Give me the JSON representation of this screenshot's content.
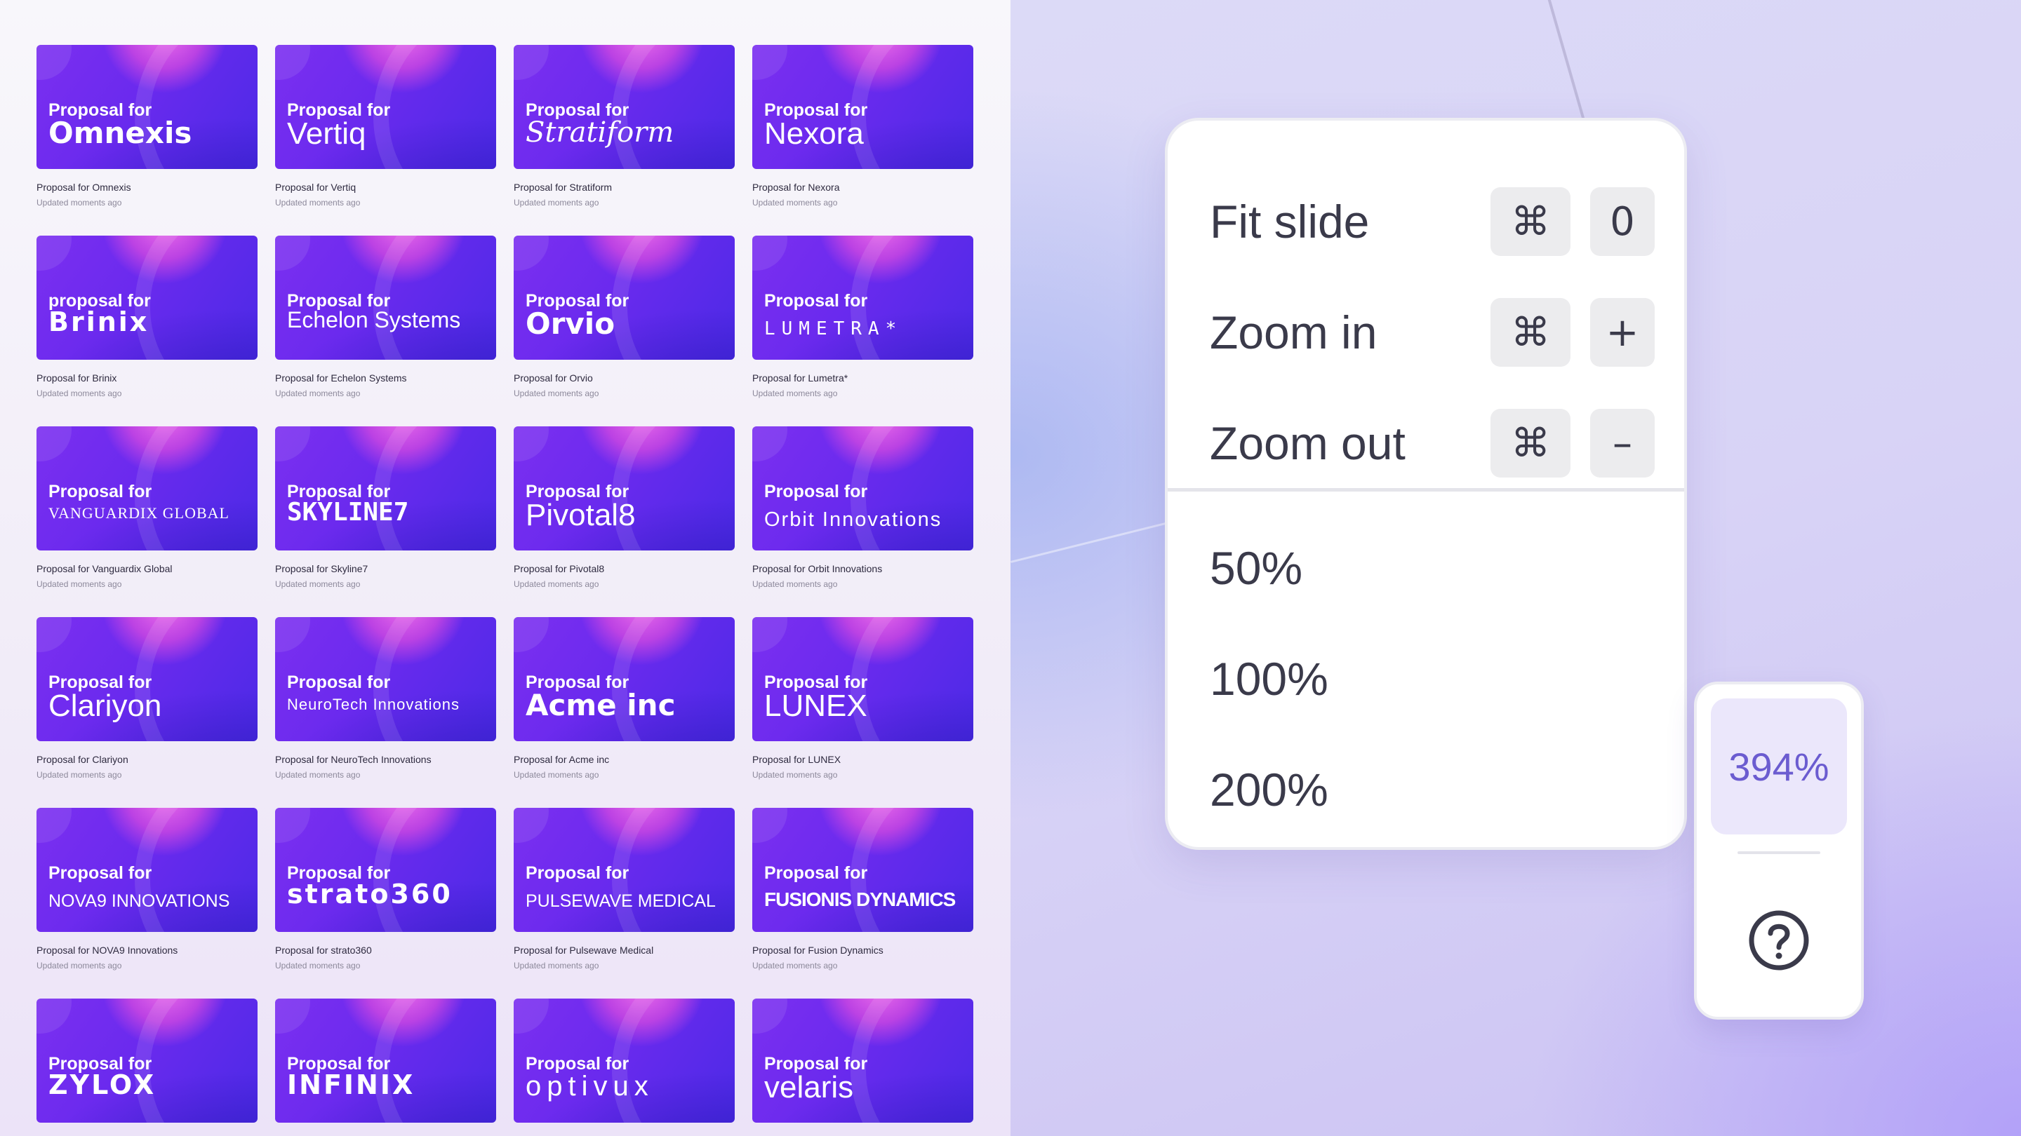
{
  "cards": [
    {
      "kicker": "Proposal for",
      "brand": "Omnexis",
      "style": "b-heavy",
      "title": "Proposal for Omnexis",
      "updated": "Updated moments ago"
    },
    {
      "kicker": "Proposal for",
      "brand": "Vertiq",
      "style": "b-light",
      "title": "Proposal for Vertiq",
      "updated": "Updated moments ago"
    },
    {
      "kicker": "Proposal for",
      "brand": "Stratiform",
      "style": "b-script",
      "title": "Proposal for Stratiform",
      "updated": "Updated moments ago"
    },
    {
      "kicker": "Proposal for",
      "brand": "Nexora",
      "style": "b-light",
      "title": "Proposal for Nexora",
      "updated": "Updated moments ago"
    },
    {
      "kicker": "proposal for",
      "brand": "Brinix",
      "style": "b-wide",
      "title": "Proposal for Brinix",
      "updated": "Updated moments ago"
    },
    {
      "kicker": "Proposal for",
      "brand": "Echelon Systems",
      "style": "b-mid",
      "title": "Proposal for Echelon Systems",
      "updated": "Updated moments ago"
    },
    {
      "kicker": "Proposal for",
      "brand": "Orvio",
      "style": "b-heavy",
      "title": "Proposal for Orvio",
      "updated": "Updated moments ago"
    },
    {
      "kicker": "Proposal for",
      "brand": "LUMETRA*",
      "style": "b-spaced",
      "title": "Proposal for Lumetra*",
      "updated": "Updated moments ago"
    },
    {
      "kicker": "Proposal for",
      "brand": "Vanguardix Global",
      "style": "b-serif-small",
      "title": "Proposal for Vanguardix Global",
      "updated": "Updated moments ago"
    },
    {
      "kicker": "Proposal for",
      "brand": "SKYLINE7",
      "style": "b-mono",
      "title": "Proposal for Skyline7",
      "updated": "Updated moments ago"
    },
    {
      "kicker": "Proposal for",
      "brand": "Pivotal8",
      "style": "b-light",
      "title": "Proposal for Pivotal8",
      "updated": "Updated moments ago"
    },
    {
      "kicker": "Proposal for",
      "brand": "Orbit Innovations",
      "style": "b-orbit",
      "title": "Proposal for Orbit Innovations",
      "updated": "Updated moments ago"
    },
    {
      "kicker": "Proposal for",
      "brand": "Clariyon",
      "style": "b-light",
      "title": "Proposal for Clariyon",
      "updated": "Updated moments ago"
    },
    {
      "kicker": "Proposal for",
      "brand": "NeuroTech Innovations",
      "style": "b-small2",
      "title": "Proposal for NeuroTech Innovations",
      "updated": "Updated moments ago"
    },
    {
      "kicker": "Proposal for",
      "brand": "Acme inc",
      "style": "b-heavy",
      "title": "Proposal for Acme inc",
      "updated": "Updated moments ago"
    },
    {
      "kicker": "Proposal for",
      "brand": "LUNEX",
      "style": "b-light",
      "title": "Proposal for LUNEX",
      "updated": "Updated moments ago"
    },
    {
      "kicker": "Proposal for",
      "brand": "NOVA9 INNOVATIONS",
      "style": "b-caps-sm",
      "title": "Proposal for NOVA9 Innovations",
      "updated": "Updated moments ago"
    },
    {
      "kicker": "Proposal for",
      "brand": "strato360",
      "style": "b-wide",
      "title": "Proposal for strato360",
      "updated": "Updated moments ago"
    },
    {
      "kicker": "Proposal for",
      "brand": "PULSEWAVE MEDICAL",
      "style": "b-caps-sm",
      "title": "Proposal for Pulsewave Medical",
      "updated": "Updated moments ago"
    },
    {
      "kicker": "Proposal for",
      "brand": "FUSIONIS DYNAMICS",
      "style": "b-narrow",
      "title": "Proposal for Fusion Dynamics",
      "updated": "Updated moments ago"
    },
    {
      "kicker": "Proposal for",
      "brand": "ZYLOX",
      "style": "b-wide",
      "title": "",
      "updated": ""
    },
    {
      "kicker": "Proposal for",
      "brand": "INFINIX",
      "style": "b-wide",
      "title": "",
      "updated": ""
    },
    {
      "kicker": "Proposal for",
      "brand": "optivux",
      "style": "b-opt",
      "title": "",
      "updated": ""
    },
    {
      "kicker": "Proposal for",
      "brand": "velaris",
      "style": "b-light",
      "title": "",
      "updated": ""
    }
  ],
  "zoom_menu": {
    "items": [
      {
        "label": "Fit slide",
        "modifier_icon": "command-icon",
        "modifier": "⌘",
        "key": "0"
      },
      {
        "label": "Zoom in",
        "modifier_icon": "command-icon",
        "modifier": "⌘",
        "key": "+"
      },
      {
        "label": "Zoom out",
        "modifier_icon": "command-icon",
        "modifier": "⌘",
        "key": "–"
      }
    ],
    "presets": [
      "50%",
      "100%",
      "200%"
    ]
  },
  "zoom_widget": {
    "current_zoom": "394%",
    "help_icon": "question-circle-icon"
  },
  "colors": {
    "card_gradient_start": "#7b2ff0",
    "card_gradient_end": "#4b2ae6",
    "accent": "#6b5cd0",
    "zoom_badge_bg": "#ebe7fb"
  }
}
